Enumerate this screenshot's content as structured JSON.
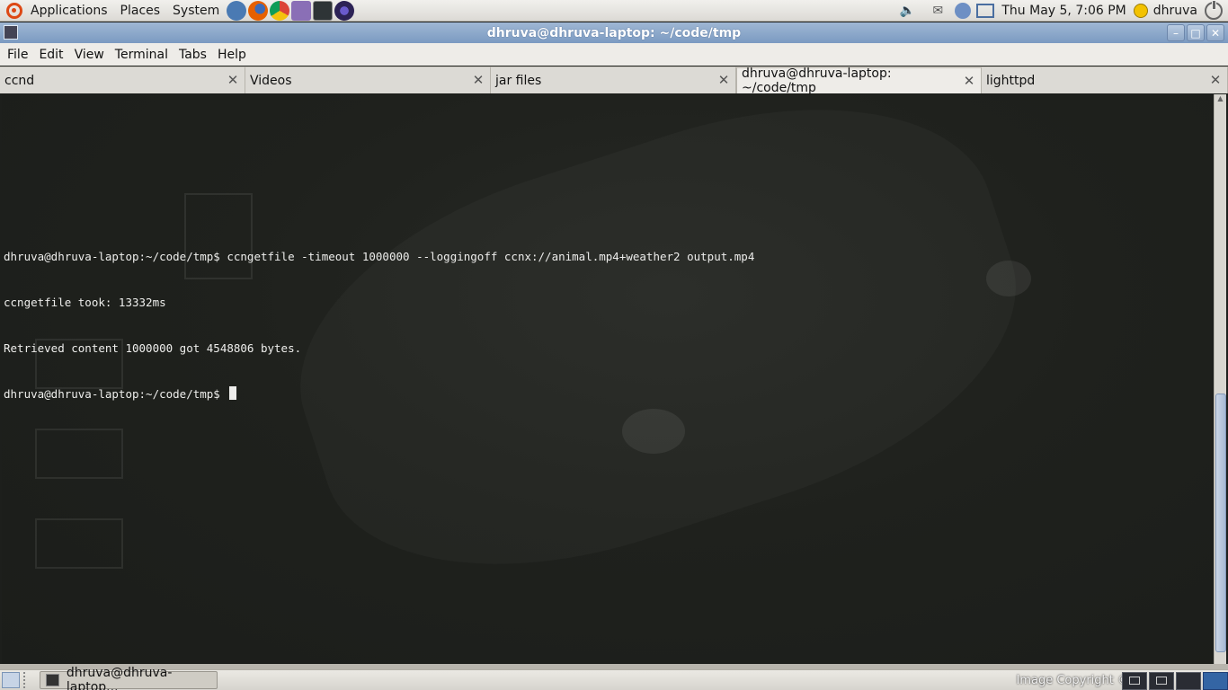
{
  "top_panel": {
    "menus": [
      "Applications",
      "Places",
      "System"
    ],
    "launchers": [
      {
        "name": "network-icon",
        "color": "#4a7ab3"
      },
      {
        "name": "firefox-icon",
        "color": "#e66000"
      },
      {
        "name": "chrome-icon",
        "color": "#3f9b4a"
      },
      {
        "name": "pidgin-icon",
        "color": "#8a6fb6"
      },
      {
        "name": "terminal-icon",
        "color": "#2e3436"
      },
      {
        "name": "eclipse-icon",
        "color": "#2c2255"
      }
    ],
    "clock": "Thu May  5,  7:06 PM",
    "user": "dhruva"
  },
  "window": {
    "title": "dhruva@dhruva-laptop: ~/code/tmp"
  },
  "menubar": [
    "File",
    "Edit",
    "View",
    "Terminal",
    "Tabs",
    "Help"
  ],
  "tabs": [
    {
      "label": "ccnd",
      "active": false
    },
    {
      "label": "Videos",
      "active": false
    },
    {
      "label": "jar files",
      "active": false
    },
    {
      "label": "dhruva@dhruva-laptop: ~/code/tmp",
      "active": true
    },
    {
      "label": "lighttpd",
      "active": false
    }
  ],
  "terminal": {
    "lines": [
      "dhruva@dhruva-laptop:~/code/tmp$ ccngetfile -timeout 1000000 --loggingoff ccnx://animal.mp4+weather2 output.mp4",
      "ccngetfile took: 13332ms",
      "Retrieved content 1000000 got 4548806 bytes.",
      "dhruva@dhruva-laptop:~/code/tmp$ "
    ]
  },
  "bottom_panel": {
    "task_label": "dhruva@dhruva-laptop...",
    "copyright": "Image Copyright ©"
  }
}
